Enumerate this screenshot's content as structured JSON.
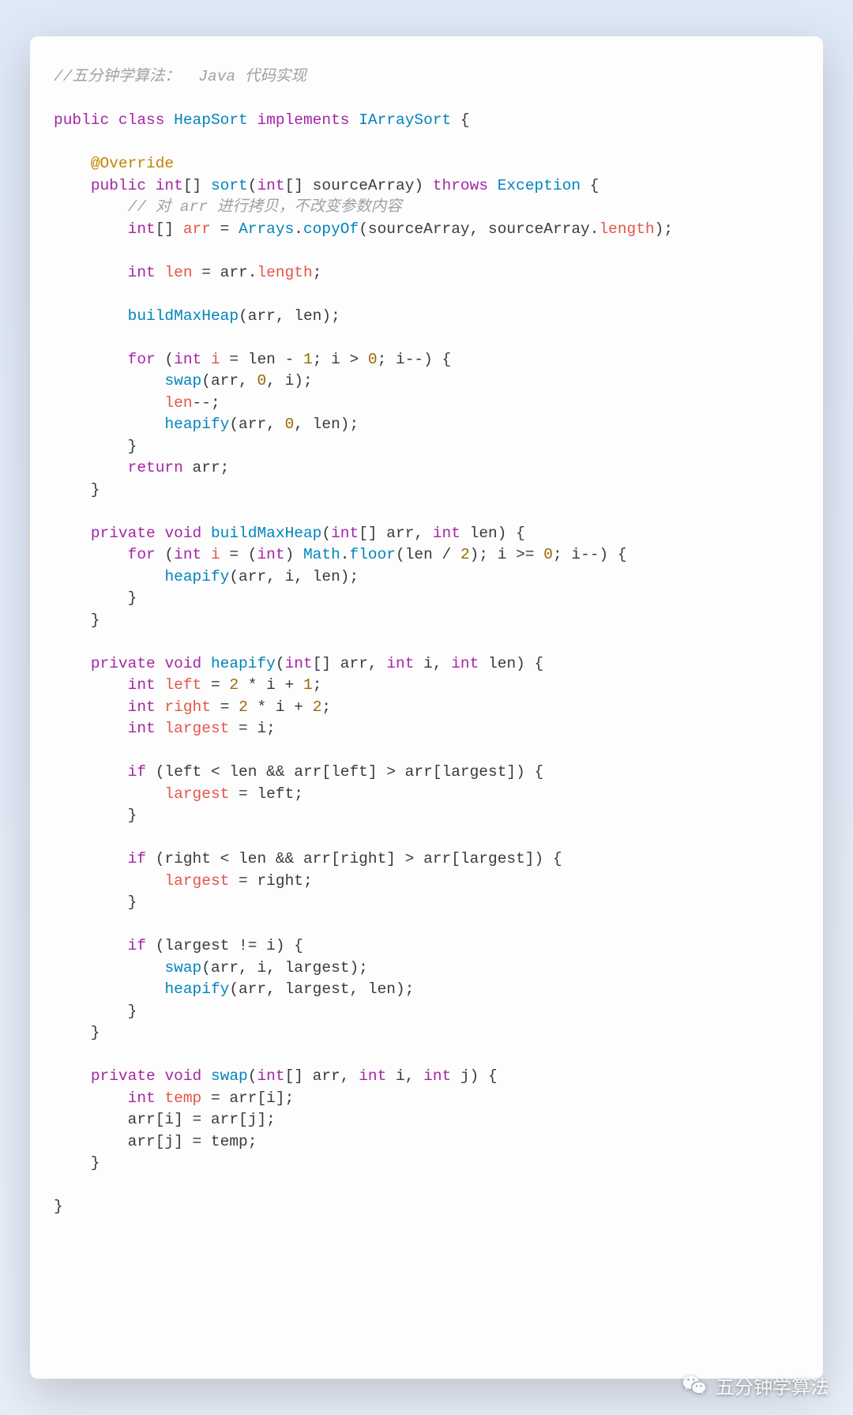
{
  "watermark": {
    "label": "五分钟学算法"
  },
  "code": {
    "lines": [
      [
        [
          "c-comment",
          "//五分钟学算法：  Java 代码实现"
        ]
      ],
      [],
      [
        [
          "c-kw",
          "public"
        ],
        [
          "c-plain",
          " "
        ],
        [
          "c-kw",
          "class"
        ],
        [
          "c-plain",
          " "
        ],
        [
          "c-type",
          "HeapSort"
        ],
        [
          "c-plain",
          " "
        ],
        [
          "c-kw",
          "implements"
        ],
        [
          "c-plain",
          " "
        ],
        [
          "c-type",
          "IArraySort"
        ],
        [
          "c-plain",
          " {"
        ]
      ],
      [],
      [
        [
          "c-plain",
          "    "
        ],
        [
          "c-annot",
          "@Override"
        ]
      ],
      [
        [
          "c-plain",
          "    "
        ],
        [
          "c-kw",
          "public"
        ],
        [
          "c-plain",
          " "
        ],
        [
          "c-kw",
          "int"
        ],
        [
          "c-plain",
          "[] "
        ],
        [
          "c-type",
          "sort"
        ],
        [
          "c-plain",
          "("
        ],
        [
          "c-kw",
          "int"
        ],
        [
          "c-plain",
          "[] sourceArray) "
        ],
        [
          "c-kw",
          "throws"
        ],
        [
          "c-plain",
          " "
        ],
        [
          "c-type",
          "Exception"
        ],
        [
          "c-plain",
          " {"
        ]
      ],
      [
        [
          "c-plain",
          "        "
        ],
        [
          "c-comment",
          "// 对 arr 进行拷贝，不改变参数内容"
        ]
      ],
      [
        [
          "c-plain",
          "        "
        ],
        [
          "c-kw",
          "int"
        ],
        [
          "c-plain",
          "[] "
        ],
        [
          "c-var",
          "arr"
        ],
        [
          "c-plain",
          " = "
        ],
        [
          "c-type",
          "Arrays"
        ],
        [
          "c-plain",
          "."
        ],
        [
          "c-type",
          "copyOf"
        ],
        [
          "c-plain",
          "(sourceArray, sourceArray."
        ],
        [
          "c-var",
          "length"
        ],
        [
          "c-plain",
          ");"
        ]
      ],
      [],
      [
        [
          "c-plain",
          "        "
        ],
        [
          "c-kw",
          "int"
        ],
        [
          "c-plain",
          " "
        ],
        [
          "c-var",
          "len"
        ],
        [
          "c-plain",
          " = arr."
        ],
        [
          "c-var",
          "length"
        ],
        [
          "c-plain",
          ";"
        ]
      ],
      [],
      [
        [
          "c-plain",
          "        "
        ],
        [
          "c-type",
          "buildMaxHeap"
        ],
        [
          "c-plain",
          "(arr, len);"
        ]
      ],
      [],
      [
        [
          "c-plain",
          "        "
        ],
        [
          "c-kw",
          "for"
        ],
        [
          "c-plain",
          " ("
        ],
        [
          "c-kw",
          "int"
        ],
        [
          "c-plain",
          " "
        ],
        [
          "c-var",
          "i"
        ],
        [
          "c-plain",
          " = len - "
        ],
        [
          "c-num",
          "1"
        ],
        [
          "c-plain",
          "; i > "
        ],
        [
          "c-num",
          "0"
        ],
        [
          "c-plain",
          "; i--) {"
        ]
      ],
      [
        [
          "c-plain",
          "            "
        ],
        [
          "c-type",
          "swap"
        ],
        [
          "c-plain",
          "(arr, "
        ],
        [
          "c-num",
          "0"
        ],
        [
          "c-plain",
          ", i);"
        ]
      ],
      [
        [
          "c-plain",
          "            "
        ],
        [
          "c-var",
          "len"
        ],
        [
          "c-plain",
          "--;"
        ]
      ],
      [
        [
          "c-plain",
          "            "
        ],
        [
          "c-type",
          "heapify"
        ],
        [
          "c-plain",
          "(arr, "
        ],
        [
          "c-num",
          "0"
        ],
        [
          "c-plain",
          ", len);"
        ]
      ],
      [
        [
          "c-plain",
          "        }"
        ]
      ],
      [
        [
          "c-plain",
          "        "
        ],
        [
          "c-kw",
          "return"
        ],
        [
          "c-plain",
          " arr;"
        ]
      ],
      [
        [
          "c-plain",
          "    }"
        ]
      ],
      [],
      [
        [
          "c-plain",
          "    "
        ],
        [
          "c-kw",
          "private"
        ],
        [
          "c-plain",
          " "
        ],
        [
          "c-kw",
          "void"
        ],
        [
          "c-plain",
          " "
        ],
        [
          "c-type",
          "buildMaxHeap"
        ],
        [
          "c-plain",
          "("
        ],
        [
          "c-kw",
          "int"
        ],
        [
          "c-plain",
          "[] arr, "
        ],
        [
          "c-kw",
          "int"
        ],
        [
          "c-plain",
          " len) {"
        ]
      ],
      [
        [
          "c-plain",
          "        "
        ],
        [
          "c-kw",
          "for"
        ],
        [
          "c-plain",
          " ("
        ],
        [
          "c-kw",
          "int"
        ],
        [
          "c-plain",
          " "
        ],
        [
          "c-var",
          "i"
        ],
        [
          "c-plain",
          " = ("
        ],
        [
          "c-kw",
          "int"
        ],
        [
          "c-plain",
          ") "
        ],
        [
          "c-type",
          "Math"
        ],
        [
          "c-plain",
          "."
        ],
        [
          "c-type",
          "floor"
        ],
        [
          "c-plain",
          "(len / "
        ],
        [
          "c-num",
          "2"
        ],
        [
          "c-plain",
          "); i >= "
        ],
        [
          "c-num",
          "0"
        ],
        [
          "c-plain",
          "; i--) {"
        ]
      ],
      [
        [
          "c-plain",
          "            "
        ],
        [
          "c-type",
          "heapify"
        ],
        [
          "c-plain",
          "(arr, i, len);"
        ]
      ],
      [
        [
          "c-plain",
          "        }"
        ]
      ],
      [
        [
          "c-plain",
          "    }"
        ]
      ],
      [],
      [
        [
          "c-plain",
          "    "
        ],
        [
          "c-kw",
          "private"
        ],
        [
          "c-plain",
          " "
        ],
        [
          "c-kw",
          "void"
        ],
        [
          "c-plain",
          " "
        ],
        [
          "c-type",
          "heapify"
        ],
        [
          "c-plain",
          "("
        ],
        [
          "c-kw",
          "int"
        ],
        [
          "c-plain",
          "[] arr, "
        ],
        [
          "c-kw",
          "int"
        ],
        [
          "c-plain",
          " i, "
        ],
        [
          "c-kw",
          "int"
        ],
        [
          "c-plain",
          " len) {"
        ]
      ],
      [
        [
          "c-plain",
          "        "
        ],
        [
          "c-kw",
          "int"
        ],
        [
          "c-plain",
          " "
        ],
        [
          "c-var",
          "left"
        ],
        [
          "c-plain",
          " = "
        ],
        [
          "c-num",
          "2"
        ],
        [
          "c-plain",
          " * i + "
        ],
        [
          "c-num",
          "1"
        ],
        [
          "c-plain",
          ";"
        ]
      ],
      [
        [
          "c-plain",
          "        "
        ],
        [
          "c-kw",
          "int"
        ],
        [
          "c-plain",
          " "
        ],
        [
          "c-var",
          "right"
        ],
        [
          "c-plain",
          " = "
        ],
        [
          "c-num",
          "2"
        ],
        [
          "c-plain",
          " * i + "
        ],
        [
          "c-num",
          "2"
        ],
        [
          "c-plain",
          ";"
        ]
      ],
      [
        [
          "c-plain",
          "        "
        ],
        [
          "c-kw",
          "int"
        ],
        [
          "c-plain",
          " "
        ],
        [
          "c-var",
          "largest"
        ],
        [
          "c-plain",
          " = i;"
        ]
      ],
      [],
      [
        [
          "c-plain",
          "        "
        ],
        [
          "c-kw",
          "if"
        ],
        [
          "c-plain",
          " (left < len && arr[left] > arr[largest]) {"
        ]
      ],
      [
        [
          "c-plain",
          "            "
        ],
        [
          "c-var",
          "largest"
        ],
        [
          "c-plain",
          " = left;"
        ]
      ],
      [
        [
          "c-plain",
          "        }"
        ]
      ],
      [],
      [
        [
          "c-plain",
          "        "
        ],
        [
          "c-kw",
          "if"
        ],
        [
          "c-plain",
          " (right < len && arr[right] > arr[largest]) {"
        ]
      ],
      [
        [
          "c-plain",
          "            "
        ],
        [
          "c-var",
          "largest"
        ],
        [
          "c-plain",
          " = right;"
        ]
      ],
      [
        [
          "c-plain",
          "        }"
        ]
      ],
      [],
      [
        [
          "c-plain",
          "        "
        ],
        [
          "c-kw",
          "if"
        ],
        [
          "c-plain",
          " (largest != i) {"
        ]
      ],
      [
        [
          "c-plain",
          "            "
        ],
        [
          "c-type",
          "swap"
        ],
        [
          "c-plain",
          "(arr, i, largest);"
        ]
      ],
      [
        [
          "c-plain",
          "            "
        ],
        [
          "c-type",
          "heapify"
        ],
        [
          "c-plain",
          "(arr, largest, len);"
        ]
      ],
      [
        [
          "c-plain",
          "        }"
        ]
      ],
      [
        [
          "c-plain",
          "    }"
        ]
      ],
      [],
      [
        [
          "c-plain",
          "    "
        ],
        [
          "c-kw",
          "private"
        ],
        [
          "c-plain",
          " "
        ],
        [
          "c-kw",
          "void"
        ],
        [
          "c-plain",
          " "
        ],
        [
          "c-type",
          "swap"
        ],
        [
          "c-plain",
          "("
        ],
        [
          "c-kw",
          "int"
        ],
        [
          "c-plain",
          "[] arr, "
        ],
        [
          "c-kw",
          "int"
        ],
        [
          "c-plain",
          " i, "
        ],
        [
          "c-kw",
          "int"
        ],
        [
          "c-plain",
          " j) {"
        ]
      ],
      [
        [
          "c-plain",
          "        "
        ],
        [
          "c-kw",
          "int"
        ],
        [
          "c-plain",
          " "
        ],
        [
          "c-var",
          "temp"
        ],
        [
          "c-plain",
          " = arr[i];"
        ]
      ],
      [
        [
          "c-plain",
          "        arr[i] = arr[j];"
        ]
      ],
      [
        [
          "c-plain",
          "        arr[j] = temp;"
        ]
      ],
      [
        [
          "c-plain",
          "    }"
        ]
      ],
      [],
      [
        [
          "c-plain",
          "}"
        ]
      ]
    ]
  }
}
